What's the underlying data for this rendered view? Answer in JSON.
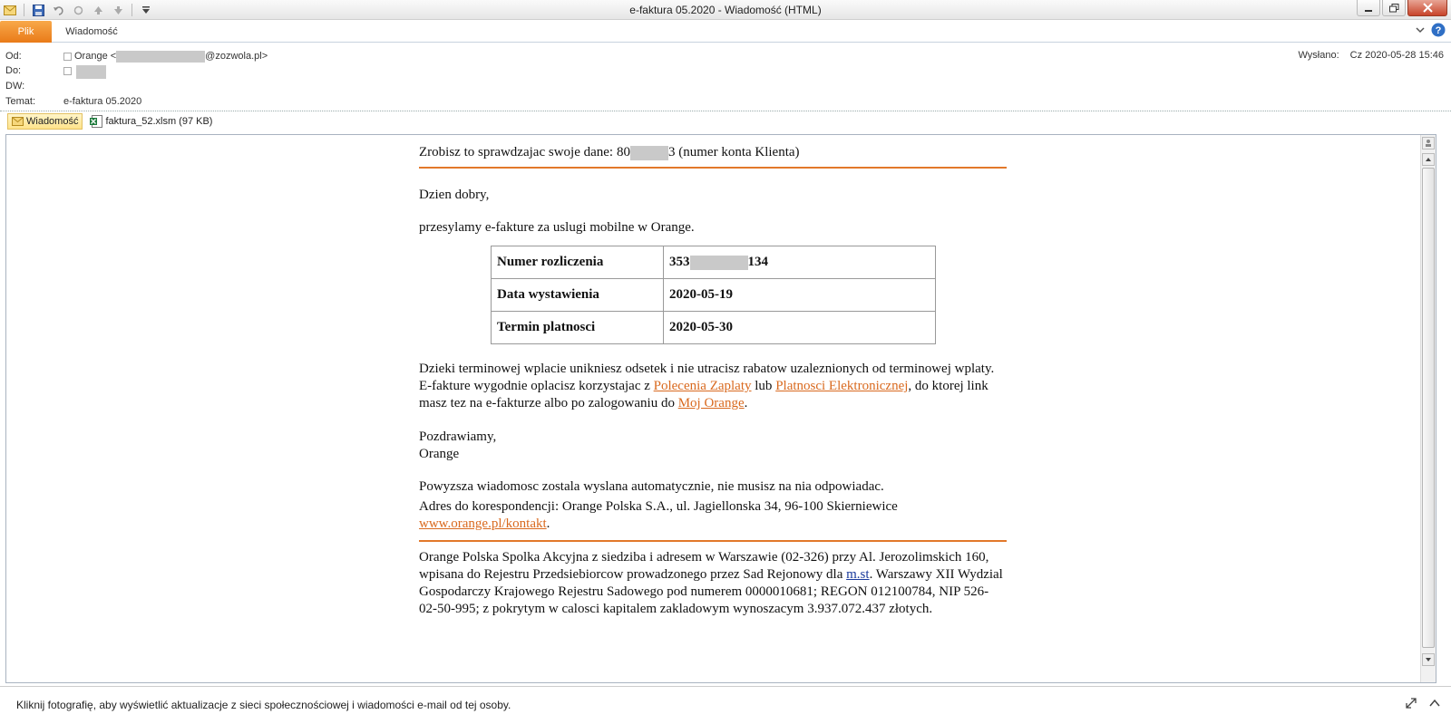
{
  "window": {
    "title": "e-faktura  05.2020  -  Wiadomość (HTML)"
  },
  "ribbon": {
    "tab_file": "Plik",
    "tab_message": "Wiadomość"
  },
  "header": {
    "from_label": "Od:",
    "from_name": "Orange <",
    "from_domain": "@zozwola.pl>",
    "to_label": "Do:",
    "cc_label": "DW:",
    "subject_label": "Temat:",
    "subject": "e-faktura  05.2020",
    "sent_label": "Wysłano:",
    "sent_value": "Cz 2020-05-28 15:46"
  },
  "attachments": {
    "message_tab": "Wiadomość",
    "file": "faktura_52.xlsm (97 KB)"
  },
  "email": {
    "check_text": "Zrobisz to sprawdzajac swoje dane:",
    "account_prefix": "80",
    "account_suffix": "3 (numer konta Klienta)",
    "greeting": "Dzien dobry,",
    "intro": "przesylamy e-fakture za uslugi mobilne w Orange.",
    "table": [
      {
        "label": "Numer rozliczenia",
        "value_prefix": "353",
        "value_suffix": "134"
      },
      {
        "label": "Data wystawienia",
        "value": "2020-05-19"
      },
      {
        "label": "Termin platnosci",
        "value": "2020-05-30"
      }
    ],
    "pay_p1": "Dzieki terminowej wplacie unikniesz odsetek i nie utracisz rabatow uzaleznionych od terminowej wplaty. E-fakture wygodnie oplacisz korzystajac z ",
    "pay_link1": "Polecenia Zaplaty",
    "pay_p2": " lub ",
    "pay_link2": "Platnosci Elektronicznej",
    "pay_p3": ", do ktorej link masz tez na e-fakturze albo po zalogowaniu do ",
    "pay_link3": "Moj Orange",
    "pay_p4": ".",
    "regards": "Pozdrawiamy,",
    "signature": "Orange",
    "auto_note": "Powyzsza wiadomosc zostala wyslana automatycznie, nie musisz na nia odpowiadac.",
    "address": "Adres do korespondencji: Orange Polska S.A., ul. Jagiellonska 34, 96-100 Skierniewice",
    "address_link": "www.orange.pl/kontakt",
    "address_end": ".",
    "legal_p1": "Orange Polska Spolka Akcyjna z siedziba i adresem w Warszawie (02-326) przy Al. Jerozolimskich 160, wpisana do Rejestru Przedsiebiorcow prowadzonego przez Sad Rejonowy dla ",
    "legal_link": "m.st",
    "legal_p2": ". Warszawy XII Wydzial Gospodarczy Krajowego Rejestru Sadowego pod numerem 0000010681; REGON 012100784, NIP 526-02-50-995; z pokrytym w calosci kapitalem zakladowym wynoszacym 3.937.072.437 złotych."
  },
  "status": {
    "text": "Kliknij fotografię, aby wyświetlić aktualizacje z sieci społecznościowej i wiadomości e-mail od tej osoby."
  },
  "colors": {
    "accent_orange": "#e2782a",
    "link_orange": "#d9691e",
    "link_blue": "#1a3a9c"
  }
}
